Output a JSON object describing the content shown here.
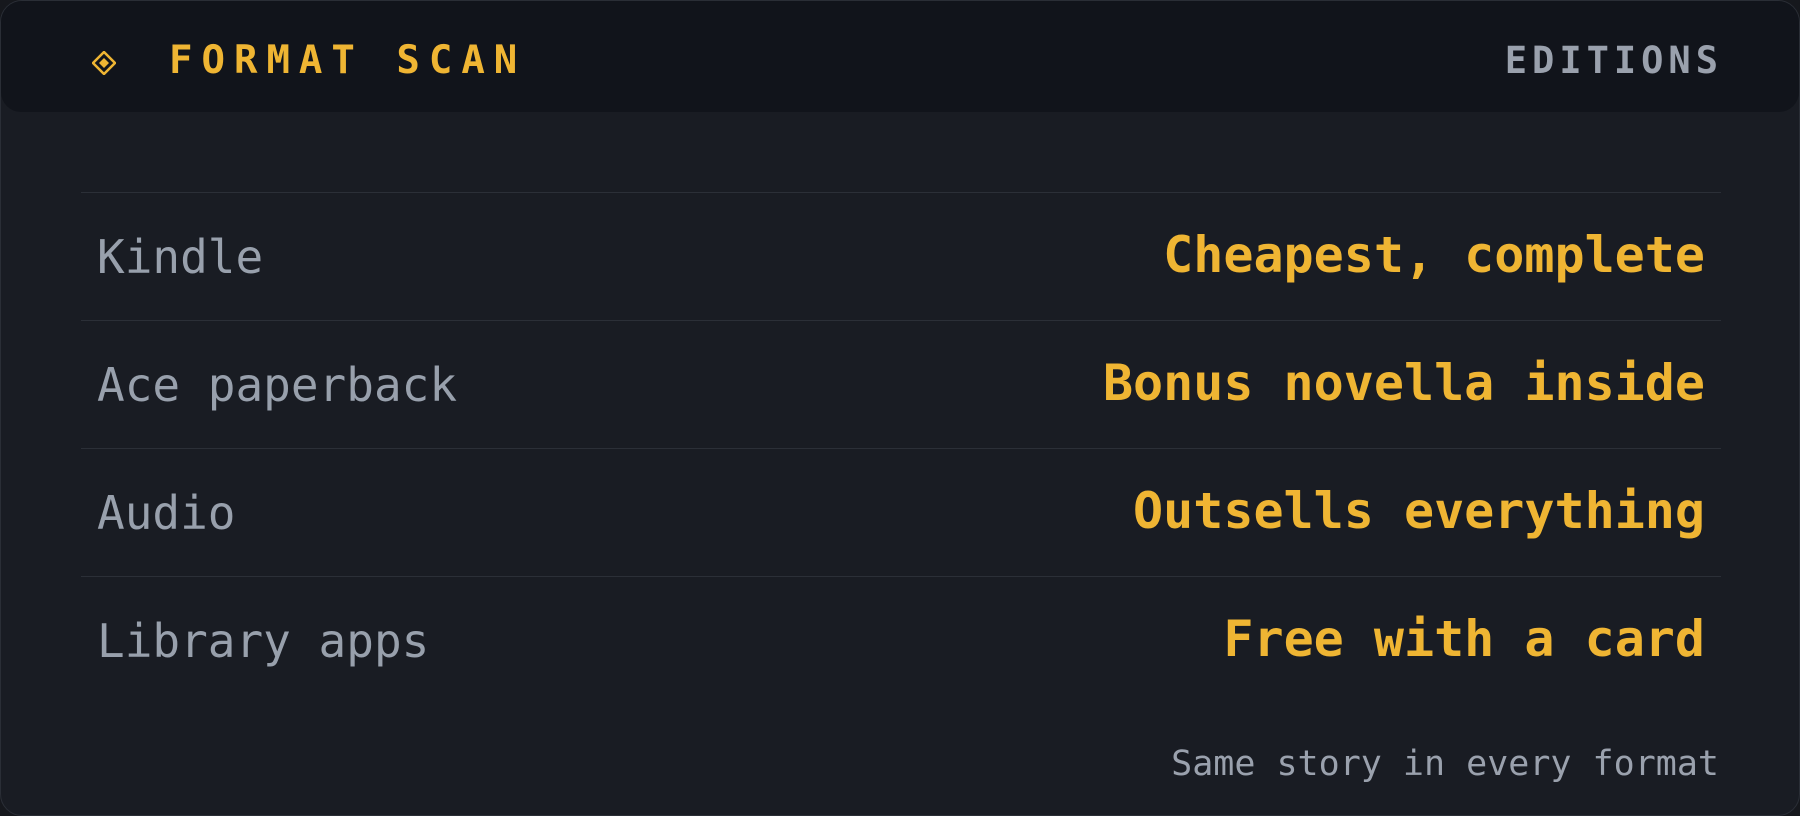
{
  "header": {
    "icon": "diamond-icon",
    "title": "FORMAT SCAN",
    "right_label": "EDITIONS"
  },
  "rows": [
    {
      "label": "Kindle",
      "value": "Cheapest, complete"
    },
    {
      "label": "Ace paperback",
      "value": "Bonus novella inside"
    },
    {
      "label": "Audio",
      "value": "Outsells everything"
    },
    {
      "label": "Library apps",
      "value": "Free with a card"
    }
  ],
  "footer": {
    "note": "Same story in every format"
  },
  "colors": {
    "accent": "#efb533",
    "muted_text": "#98a0ac",
    "background": "#191c23",
    "header_background": "#11141b"
  }
}
